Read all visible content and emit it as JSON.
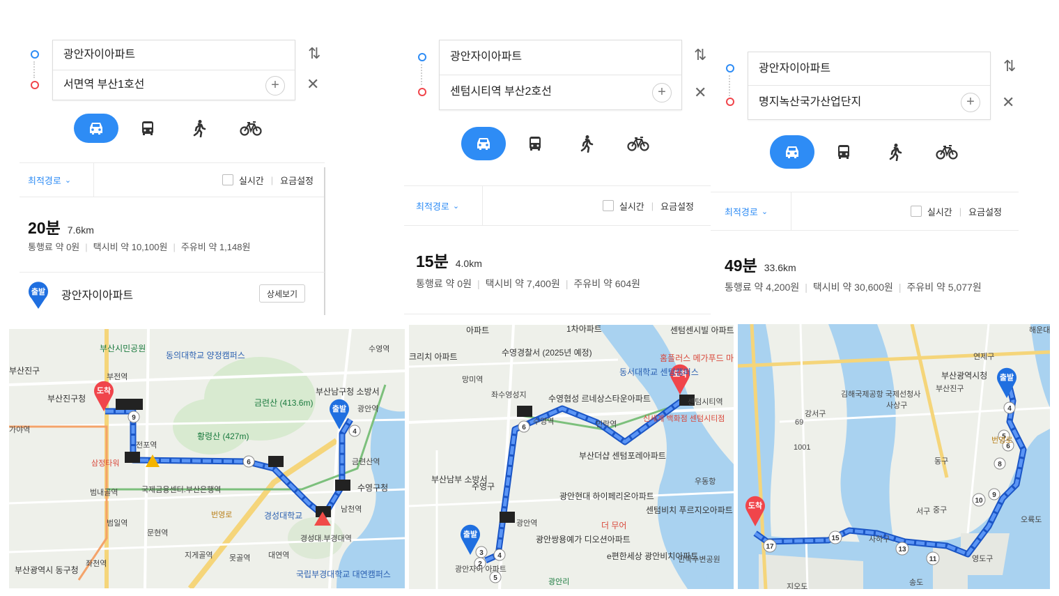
{
  "colors": {
    "accent": "#2e8cf5",
    "start_pin": "#1f6fe0",
    "end_pin": "#f0454b",
    "route": "#3a7ff2"
  },
  "panels": [
    {
      "origin": "광안자이아파트",
      "destination": "서면역 부산1호선",
      "route_option": "최적경로",
      "realtime_label": "실시간",
      "fare_label": "요금설정",
      "time": "20분",
      "distance": "7.6km",
      "toll": "통행료 약 0원",
      "taxi": "택시비 약 10,100원",
      "fuel": "주유비 약 1,148원",
      "start_badge": "출발",
      "start_name": "광안자이아파트",
      "detail_button": "상세보기"
    },
    {
      "origin": "광안자이아파트",
      "destination": "센텀시티역 부산2호선",
      "route_option": "최적경로",
      "realtime_label": "실시간",
      "fare_label": "요금설정",
      "time": "15분",
      "distance": "4.0km",
      "toll": "통행료 약 0원",
      "taxi": "택시비 약 7,400원",
      "fuel": "주유비 약 604원"
    },
    {
      "origin": "광안자이아파트",
      "destination": "명지녹산국가산업단지",
      "route_option": "최적경로",
      "realtime_label": "실시간",
      "fare_label": "요금설정",
      "time": "49분",
      "distance": "33.6km",
      "toll": "통행료 약 4,200원",
      "taxi": "택시비 약 30,600원",
      "fuel": "주유비 약 5,077원"
    }
  ],
  "icons": {
    "swap": "swap-icon",
    "close": "close-icon",
    "add": "plus-icon",
    "car": "car-icon",
    "bus": "bus-icon",
    "walk": "walk-icon",
    "bike": "bike-icon"
  },
  "maps": [
    {
      "pin_start": "출발",
      "pin_end": "도착",
      "labels": [
        "부산시민공원",
        "동의대학교 양정캠퍼스",
        "부산진구",
        "부전역",
        "부산진구청",
        "금련산 (413.6m)",
        "황령산 (427m)",
        "부산남구청 소방서",
        "수영역",
        "광안역",
        "가야역",
        "전포역",
        "삼정타워",
        "국제금융센터.부산은행역",
        "범내골역",
        "범일역",
        "문현역",
        "지게골역",
        "못골역",
        "대연역",
        "좌천역",
        "금련산역",
        "수영구청",
        "남천역",
        "경성대학교",
        "경성대.부경대역",
        "국립부경대학교 대연캠퍼스",
        "부산광역시 동구청",
        "번영로"
      ],
      "route_numbers": [
        "9",
        "6",
        "4"
      ]
    },
    {
      "pin_start": "출발",
      "pin_end": "도착",
      "labels": [
        "아파트",
        "1차아파트",
        "센텀센시빌 아파트",
        "크리치 아파트",
        "수영경찰서 (2025년 예정)",
        "홈플러스 메가푸드 마켓 라이브",
        "망미역",
        "동서대학교 센텀캠퍼스",
        "좌수영성지",
        "수영협성 르네상스타운아파트",
        "센텀시티역",
        "신세계 백화점 센텀시티점",
        "민락역",
        "수영역",
        "부산더샵 센텀포레아파트",
        "우동항",
        "부산남부 소방서",
        "수영구",
        "광안현대 하이페리온아파트",
        "센텀비치 푸르지오아파트",
        "더 무어",
        "광안역",
        "광안쌍용예가 디오션아파트",
        "e편한세상 광안비치아파트",
        "민락수변공원",
        "광안자이 아파트",
        "광안리"
      ],
      "route_numbers": [
        "6",
        "3",
        "2",
        "4",
        "5"
      ]
    },
    {
      "pin_start": "출발",
      "pin_end": "도착",
      "labels": [
        "해운대",
        "연제구",
        "부산광역시청",
        "강서구",
        "김해국제공항 국제선청사",
        "사상구",
        "부산진구",
        "동구",
        "서구",
        "중구",
        "영도구",
        "사하구",
        "송도",
        "오륙도",
        "지오도",
        "번영로",
        "69",
        "1001"
      ],
      "route_numbers": [
        "4",
        "5",
        "6",
        "8",
        "9",
        "10",
        "11",
        "13",
        "15",
        "17"
      ]
    }
  ]
}
